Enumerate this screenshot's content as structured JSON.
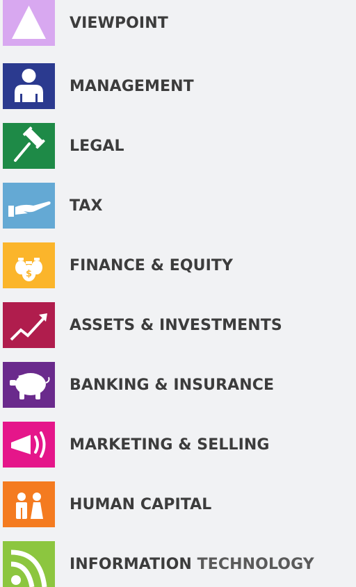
{
  "categories": [
    {
      "label": "VIEWPOINT",
      "icon": "triangle-icon",
      "color": "#d8a8f0"
    },
    {
      "label": "MANAGEMENT",
      "icon": "person-icon",
      "color": "#2b3a8f"
    },
    {
      "label": "LEGAL",
      "icon": "gavel-icon",
      "color": "#1e8a47"
    },
    {
      "label": "TAX",
      "icon": "hand-icon",
      "color": "#64a9d4"
    },
    {
      "label": "FINANCE & EQUITY",
      "icon": "money-bags-icon",
      "color": "#fbb52b"
    },
    {
      "label": "ASSETS & INVESTMENTS",
      "icon": "trend-up-icon",
      "color": "#b01d4d"
    },
    {
      "label": "BANKING & INSURANCE",
      "icon": "piggy-bank-icon",
      "color": "#6a2a8c"
    },
    {
      "label": "MARKETING & SELLING",
      "icon": "megaphone-icon",
      "color": "#e5168a"
    },
    {
      "label": "HUMAN CAPITAL",
      "icon": "people-icon",
      "color": "#f47b20"
    },
    {
      "label_part1": "INFORMATION",
      "label_part2": "TECHNOLOGY",
      "icon": "rss-icon",
      "color": "#8cc63f"
    }
  ]
}
